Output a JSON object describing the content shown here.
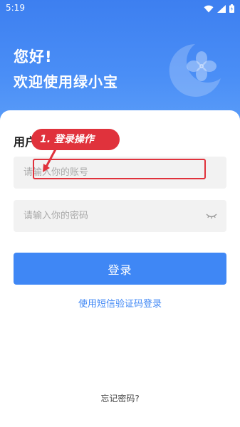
{
  "status_bar": {
    "time": "5:19"
  },
  "header": {
    "greeting_line1": "您好!",
    "greeting_line2": "欢迎使用绿小宝"
  },
  "form": {
    "title": "用户",
    "username_placeholder": "请输入你的账号",
    "password_placeholder": "请输入你的密码"
  },
  "actions": {
    "login_label": "登录",
    "sms_login_label": "使用短信验证码登录",
    "forgot_label": "忘记密码?"
  },
  "annotation": {
    "label": "1. 登录操作"
  },
  "colors": {
    "primary": "#3f87f5",
    "header_blue": "#4a8ef6",
    "annotation_red": "#e0323c",
    "field_bg": "#f2f2f2"
  }
}
